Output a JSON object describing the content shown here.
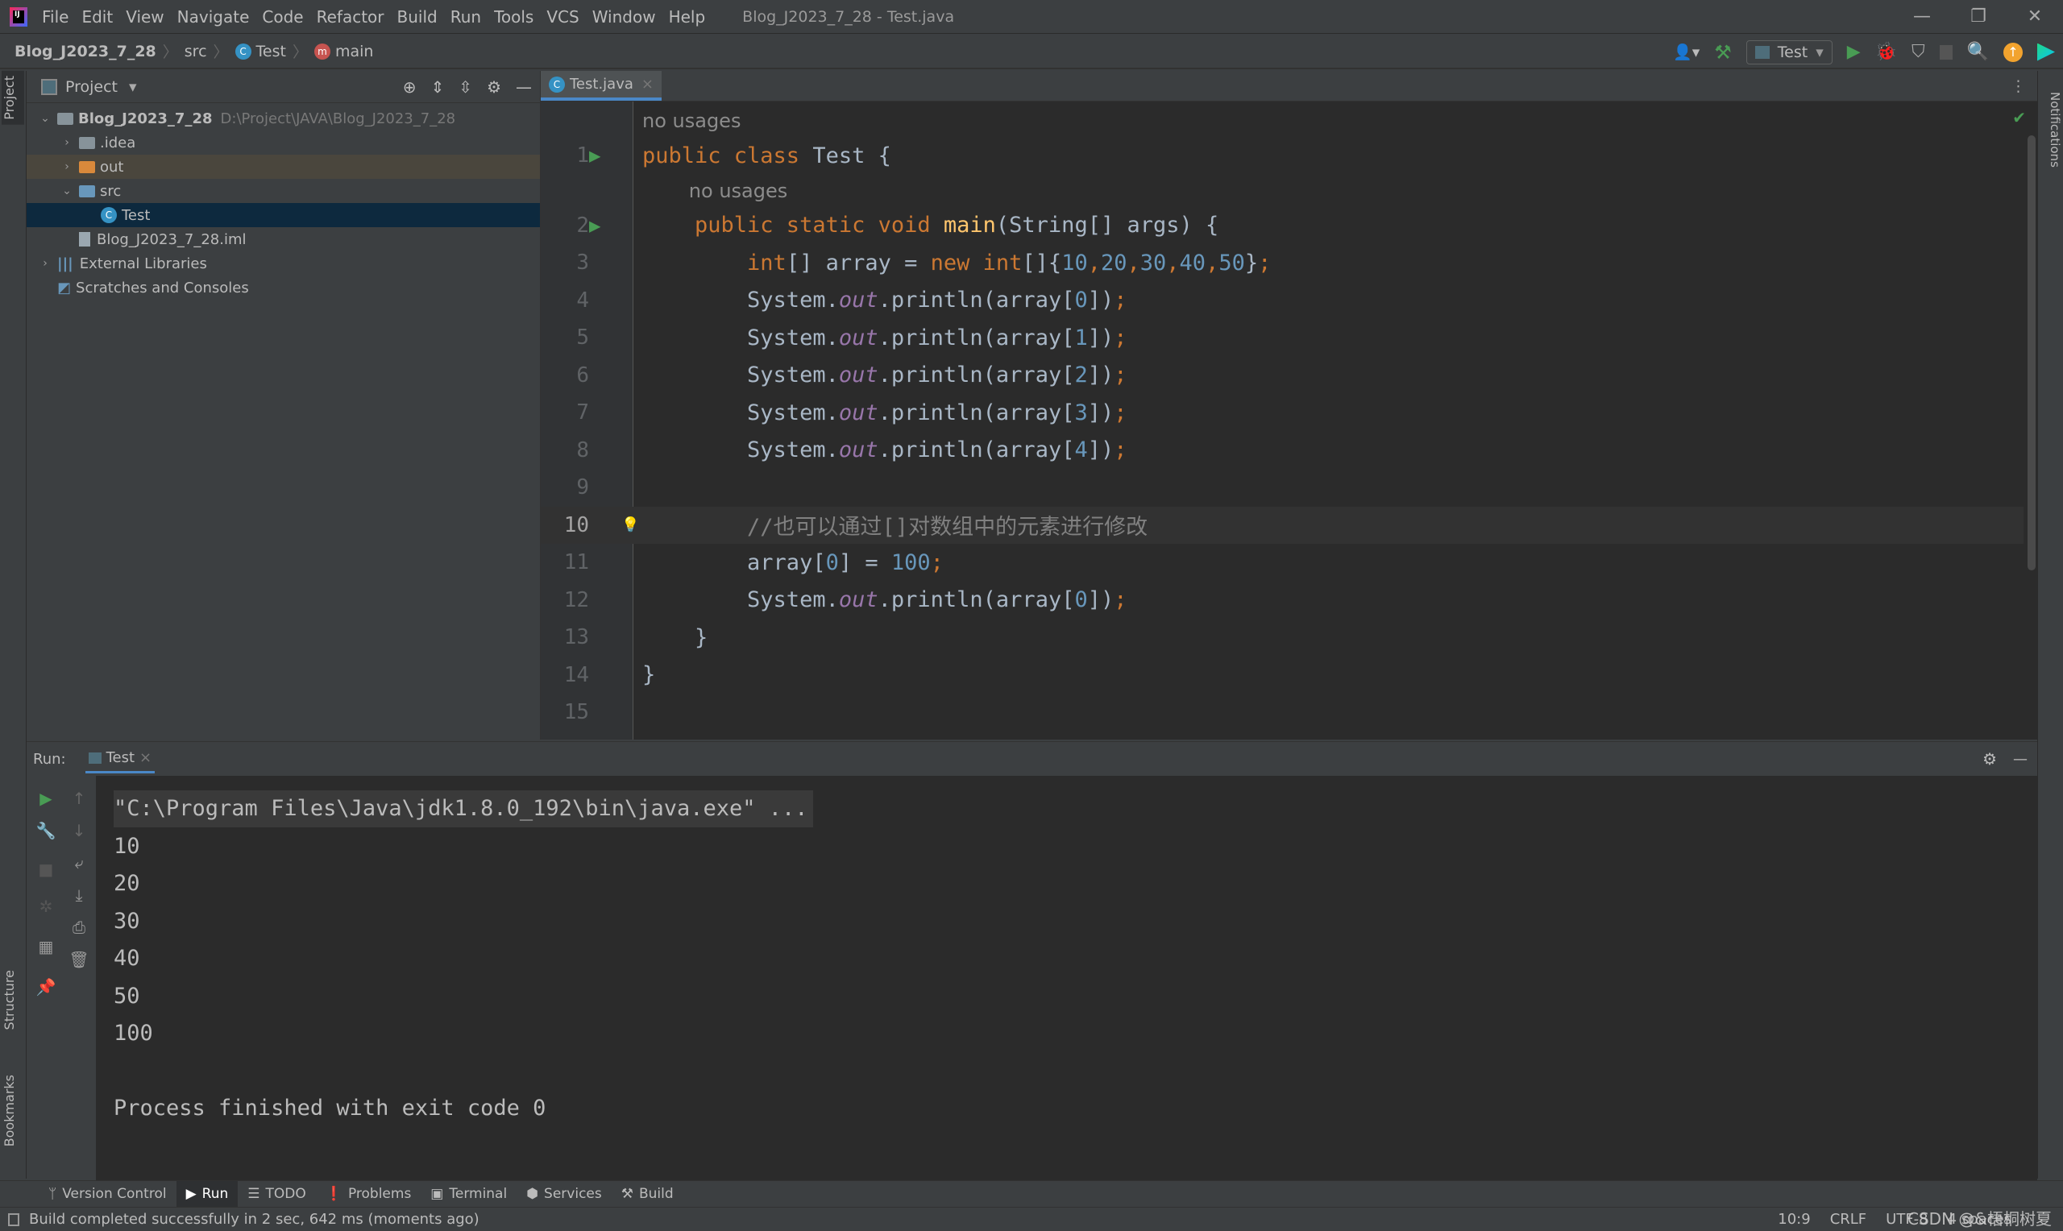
{
  "menubar": {
    "items": [
      "File",
      "Edit",
      "View",
      "Navigate",
      "Code",
      "Refactor",
      "Build",
      "Run",
      "Tools",
      "VCS",
      "Window",
      "Help"
    ],
    "window_title": "Blog_J2023_7_28 - Test.java"
  },
  "navbar": {
    "crumbs": [
      "Blog_J2023_7_28",
      "src",
      "Test",
      "main"
    ],
    "run_config": "Test"
  },
  "stripes": {
    "project": "Project",
    "structure": "Structure",
    "bookmarks": "Bookmarks",
    "notifications": "Notifications"
  },
  "project": {
    "title": "Project",
    "tree": [
      {
        "label": "Blog_J2023_7_28",
        "hint": "D:\\Project\\JAVA\\Blog_J2023_7_28",
        "depth": 0,
        "arrow": "v",
        "icon": "folder"
      },
      {
        "label": ".idea",
        "depth": 1,
        "arrow": ">",
        "icon": "folder"
      },
      {
        "label": "out",
        "depth": 1,
        "arrow": ">",
        "icon": "folder-excluded"
      },
      {
        "label": "src",
        "depth": 1,
        "arrow": "v",
        "icon": "folder-source"
      },
      {
        "label": "Test",
        "depth": 2,
        "arrow": "",
        "icon": "class"
      },
      {
        "label": "Blog_J2023_7_28.iml",
        "depth": 1,
        "arrow": "",
        "icon": "file"
      },
      {
        "label": "External Libraries",
        "depth": 0,
        "arrow": ">",
        "icon": "library"
      },
      {
        "label": "Scratches and Consoles",
        "depth": 0,
        "arrow": "",
        "icon": "scratches"
      }
    ]
  },
  "editor": {
    "tab": "Test.java",
    "current_line": 10,
    "lines": [
      {
        "n": "",
        "inlay": "no usages",
        "indent": 0
      },
      {
        "n": "1",
        "run": true,
        "tokens": [
          [
            "public class ",
            "kw"
          ],
          [
            "Test {",
            ""
          ]
        ]
      },
      {
        "n": "",
        "inlay": "no usages",
        "indent": 1
      },
      {
        "n": "2",
        "run": true,
        "tokens": [
          [
            "    public static void ",
            "kw"
          ],
          [
            "main",
            "fn"
          ],
          [
            "(String[] args) {",
            ""
          ]
        ]
      },
      {
        "n": "3",
        "tokens": [
          [
            "        int",
            "kw"
          ],
          [
            "[] array = ",
            ""
          ],
          [
            "new int",
            "kw"
          ],
          [
            "[]{",
            ""
          ],
          [
            "10",
            "num"
          ],
          [
            ",",
            "kw"
          ],
          [
            "20",
            "num"
          ],
          [
            ",",
            "kw"
          ],
          [
            "30",
            "num"
          ],
          [
            ",",
            "kw"
          ],
          [
            "40",
            "num"
          ],
          [
            ",",
            "kw"
          ],
          [
            "50",
            "num"
          ],
          [
            "}",
            ""
          ],
          [
            ";",
            "kw"
          ]
        ]
      },
      {
        "n": "4",
        "tokens": [
          [
            "        System.",
            ""
          ],
          [
            "out",
            "st"
          ],
          [
            ".println(array[",
            ""
          ],
          [
            "0",
            "num"
          ],
          [
            "])",
            ""
          ],
          [
            ";",
            "kw"
          ]
        ]
      },
      {
        "n": "5",
        "tokens": [
          [
            "        System.",
            ""
          ],
          [
            "out",
            "st"
          ],
          [
            ".println(array[",
            ""
          ],
          [
            "1",
            "num"
          ],
          [
            "])",
            ""
          ],
          [
            ";",
            "kw"
          ]
        ]
      },
      {
        "n": "6",
        "tokens": [
          [
            "        System.",
            ""
          ],
          [
            "out",
            "st"
          ],
          [
            ".println(array[",
            ""
          ],
          [
            "2",
            "num"
          ],
          [
            "])",
            ""
          ],
          [
            ";",
            "kw"
          ]
        ]
      },
      {
        "n": "7",
        "tokens": [
          [
            "        System.",
            ""
          ],
          [
            "out",
            "st"
          ],
          [
            ".println(array[",
            ""
          ],
          [
            "3",
            "num"
          ],
          [
            "])",
            ""
          ],
          [
            ";",
            "kw"
          ]
        ]
      },
      {
        "n": "8",
        "tokens": [
          [
            "        System.",
            ""
          ],
          [
            "out",
            "st"
          ],
          [
            ".println(array[",
            ""
          ],
          [
            "4",
            "num"
          ],
          [
            "])",
            ""
          ],
          [
            ";",
            "kw"
          ]
        ]
      },
      {
        "n": "9",
        "tokens": []
      },
      {
        "n": "10",
        "bulb": true,
        "tokens": [
          [
            "        //也可以通过[]对数组中的元素进行修改",
            "cm"
          ]
        ]
      },
      {
        "n": "11",
        "tokens": [
          [
            "        array[",
            ""
          ],
          [
            "0",
            "num"
          ],
          [
            "] = ",
            ""
          ],
          [
            "100",
            "num"
          ],
          [
            ";",
            "kw"
          ]
        ]
      },
      {
        "n": "12",
        "tokens": [
          [
            "        System.",
            ""
          ],
          [
            "out",
            "st"
          ],
          [
            ".println(array[",
            ""
          ],
          [
            "0",
            "num"
          ],
          [
            "])",
            ""
          ],
          [
            ";",
            "kw"
          ]
        ]
      },
      {
        "n": "13",
        "tokens": [
          [
            "    }",
            ""
          ]
        ]
      },
      {
        "n": "14",
        "tokens": [
          [
            "}",
            ""
          ]
        ]
      },
      {
        "n": "15",
        "tokens": []
      }
    ]
  },
  "run": {
    "label": "Run:",
    "tab": "Test",
    "output": [
      "\"C:\\Program Files\\Java\\jdk1.8.0_192\\bin\\java.exe\" ...",
      "10",
      "20",
      "30",
      "40",
      "50",
      "100",
      "",
      "Process finished with exit code 0"
    ]
  },
  "bottombar": [
    "Version Control",
    "Run",
    "TODO",
    "Problems",
    "Terminal",
    "Services",
    "Build"
  ],
  "status": {
    "message": "Build completed successfully in 2 sec, 642 ms (moments ago)",
    "position": "10:9",
    "line_sep": "CRLF",
    "encoding": "UTF-8",
    "indent": "4 spaces",
    "watermark": "CSDN @&梧桐树夏"
  }
}
